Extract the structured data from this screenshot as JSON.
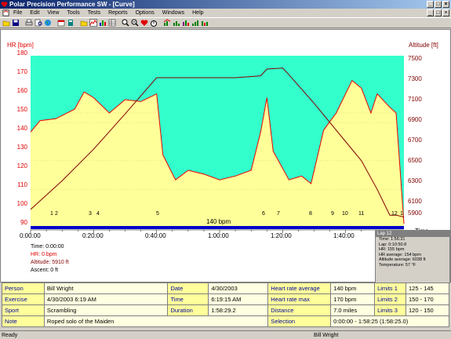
{
  "window": {
    "title": "Polar Precision Performance SW - [Curve]"
  },
  "menu": [
    "File",
    "Edit",
    "View",
    "Tools",
    "Tests",
    "Reports",
    "Options",
    "Windows",
    "Help"
  ],
  "chart": {
    "hr_axis_title": "HR [bpm]",
    "alt_axis_title": "Altitude [ft]",
    "hr_ticks": [
      "180",
      "170",
      "160",
      "150",
      "140",
      "130",
      "120",
      "110",
      "100",
      "90"
    ],
    "alt_ticks": [
      "7500",
      "7300",
      "7100",
      "6900",
      "6700",
      "6500",
      "6300",
      "6100",
      "5900"
    ],
    "time_ticks": [
      "0:00:00",
      "0:20:00",
      "0:40:00",
      "1:00:00",
      "1:20:00",
      "1:40:00"
    ],
    "time_axis_label": "Time",
    "lap_labels": [
      "1",
      "2",
      "3",
      "4",
      "5",
      "6",
      "7",
      "8",
      "9",
      "10",
      "11",
      "12",
      "1"
    ],
    "limit_label": "140 bpm",
    "colors": {
      "zone_band": "#33ffcc",
      "fill": "#ffff99",
      "hr_line": "#ee0000",
      "alt_line": "#800000",
      "limit_line": "#0000cc"
    }
  },
  "chart_data": {
    "type": "line",
    "x_unit": "time",
    "xlim": [
      "0:00:00",
      "1:58:29"
    ],
    "hr_ylim": [
      90,
      180
    ],
    "alt_ylim": [
      5800,
      7600
    ],
    "series": [
      {
        "name": "HR",
        "x": [
          "0:00:00",
          "0:03:00",
          "0:08:00",
          "0:14:00",
          "0:17:00",
          "0:20:00",
          "0:25:00",
          "0:30:00",
          "0:35:00",
          "0:40:00",
          "0:42:00",
          "0:46:00",
          "0:50:00",
          "0:55:00",
          "1:00:00",
          "1:05:00",
          "1:10:00",
          "1:13:00",
          "1:15:00",
          "1:17:00",
          "1:22:00",
          "1:26:00",
          "1:29:00",
          "1:33:00",
          "1:37:00",
          "1:42:00",
          "1:45:00",
          "1:48:00",
          "1:50:00",
          "1:54:00",
          "1:56:00",
          "1:58:29"
        ],
        "values": [
          140,
          146,
          147,
          152,
          161,
          158,
          150,
          157,
          156,
          160,
          128,
          115,
          120,
          118,
          115,
          117,
          120,
          140,
          158,
          130,
          115,
          117,
          113,
          141,
          150,
          167,
          163,
          150,
          160,
          153,
          150,
          92
        ]
      },
      {
        "name": "Altitude",
        "x": [
          "0:00:00",
          "0:10:00",
          "0:20:00",
          "0:30:00",
          "0:40:00",
          "0:45:00",
          "0:55:00",
          "1:05:00",
          "1:13:00",
          "1:15:00",
          "1:20:00",
          "1:22:00",
          "1:30:00",
          "1:40:00",
          "1:45:00",
          "1:50:00",
          "1:54:00",
          "1:56:00",
          "1:58:29"
        ],
        "values": [
          5990,
          6290,
          6620,
          6990,
          7370,
          7370,
          7370,
          7370,
          7390,
          7460,
          7470,
          7400,
          7100,
          6700,
          6500,
          6200,
          5930,
          5930,
          5910
        ]
      }
    ],
    "limit_bpm": 140
  },
  "cursor": {
    "time": "Time: 0:00:00",
    "hr": "HR: 0 bpm",
    "altitude": "Altitude: 5910 ft",
    "ascent": "Ascent: 0 ft"
  },
  "lap_box": {
    "title": "Lap 12",
    "lines": [
      "Time: 1:56:31",
      "Lap: 0:10:50.8",
      "HR: 155 bpm",
      "HR average: 154 bpm",
      "Altitude average: 6038 ft",
      "Temperature: 57 °F"
    ]
  },
  "info": {
    "person_label": "Person",
    "person": "Bill Wright",
    "date_label": "Date",
    "date": "4/30/2003",
    "hr_avg_label": "Heart rate average",
    "hr_avg": "140 bpm",
    "limits1_label": "Limits 1",
    "limits1": "125 - 145",
    "exercise_label": "Exercise",
    "exercise": "4/30/2003 6:19 AM",
    "time_label": "Time",
    "time": "6:19:15 AM",
    "hr_max_label": "Heart rate max",
    "hr_max": "170 bpm",
    "limits2_label": "Limits 2",
    "limits2": "150 - 170",
    "sport_label": "Sport",
    "sport": "Scrambling",
    "duration_label": "Duration",
    "duration": "1:58:29.2",
    "distance_label": "Distance",
    "distance": "7.0 miles",
    "limits3_label": "Limits 3",
    "limits3": "120 - 150",
    "note_label": "Note",
    "note": "Roped solo of the Maiden",
    "selection_label": "Selection",
    "selection": "0:00:00 - 1:58:25 (1:58:25.0)"
  },
  "status": {
    "left": "Ready",
    "user": "Bill Wright"
  }
}
